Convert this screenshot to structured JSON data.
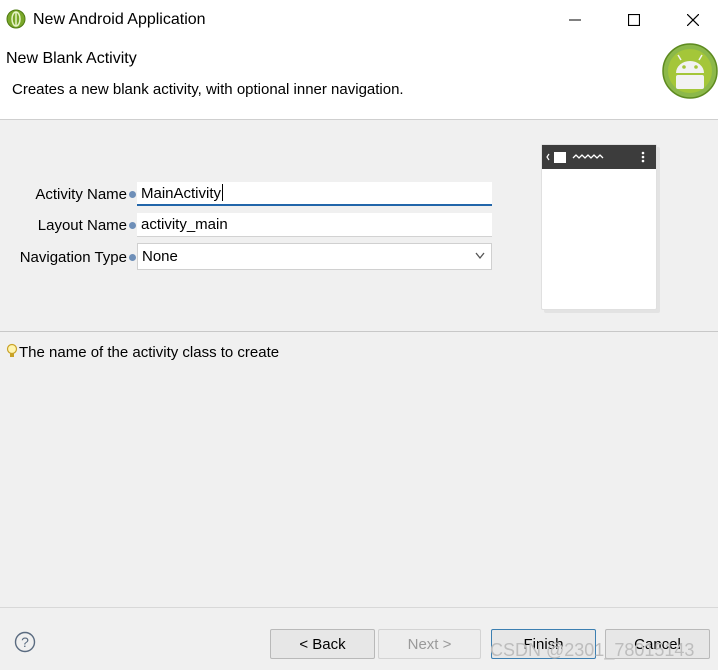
{
  "window": {
    "title": "New Android Application"
  },
  "banner": {
    "title": "New Blank Activity",
    "description": "Creates a new blank activity, with optional inner navigation."
  },
  "form": {
    "activity_name_label": "Activity Name",
    "activity_name_value": "MainActivity",
    "layout_name_label": "Layout Name",
    "layout_name_value": "activity_main",
    "navigation_type_label": "Navigation Type",
    "navigation_type_value": "None"
  },
  "hint": {
    "text": "The name of the activity class to create"
  },
  "buttons": {
    "back": "< Back",
    "next": "Next >",
    "finish": "Finish",
    "cancel": "Cancel"
  },
  "watermark": "CSDN @2301_78015143",
  "colors": {
    "accent": "#2266aa",
    "android_green": "#a4c639"
  }
}
